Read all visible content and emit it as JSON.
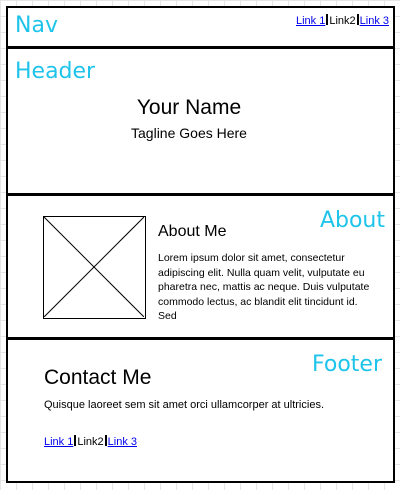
{
  "nav": {
    "annotation": "Nav",
    "links": [
      {
        "label": "Link 1",
        "active": false
      },
      {
        "label": "Link2",
        "active": true
      },
      {
        "label": "Link 3",
        "active": false
      }
    ]
  },
  "header": {
    "annotation": "Header",
    "name": "Your Name",
    "tagline": "Tagline Goes Here"
  },
  "about": {
    "annotation": "About",
    "image_icon": "image-placeholder-icon",
    "title": "About Me",
    "body": "Lorem ipsum dolor sit amet, consectetur adipiscing elit. Nulla quam velit, vulputate eu pharetra nec, mattis ac neque. Duis vulputate commodo lectus, ac blandit elit tincidunt id. Sed"
  },
  "footer": {
    "annotation": "Footer",
    "title": "Contact Me",
    "text": "Quisque laoreet sem sit amet orci ullamcorper at ultricies.",
    "links": [
      {
        "label": "Link 1",
        "active": false
      },
      {
        "label": "Link2",
        "active": true
      },
      {
        "label": "Link 3",
        "active": false
      }
    ]
  },
  "colors": {
    "annotation": "#1ec4ea",
    "link": "#0000ee",
    "border": "#000000",
    "grid": "#e6e6e6"
  }
}
